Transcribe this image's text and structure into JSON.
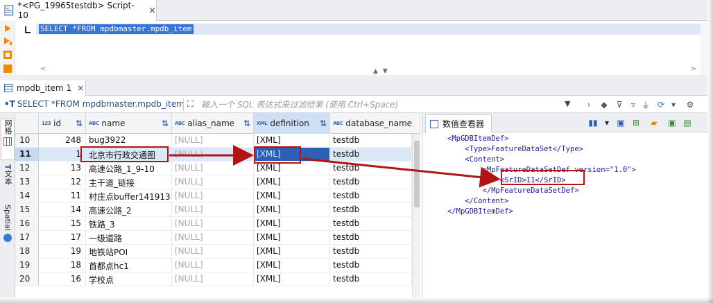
{
  "editor": {
    "tab_title": "*<PG_19965testdb> Script-10",
    "sql": "SELECT *FROM mpdbmaster.mpdb_item"
  },
  "results": {
    "tab_label": "mpdb_item 1",
    "query_text": "SELECT *FROM mpdbmaster.mpdb_item",
    "filter_placeholder": "输入一个 SQL 表达式来过滤结果 (使用 Ctrl+Space)",
    "side_tabs": [
      "网格",
      "文本",
      "Spatial"
    ],
    "columns": [
      {
        "type": "123",
        "name": "id"
      },
      {
        "type": "ABC",
        "name": "name"
      },
      {
        "type": "ABC",
        "name": "alias_name"
      },
      {
        "type": "XML",
        "name": "definition"
      },
      {
        "type": "ABC",
        "name": "database_name"
      }
    ],
    "rows": [
      {
        "n": "10",
        "id": "248",
        "name": "bug3922",
        "alias": "[NULL]",
        "def": "[XML]",
        "db": "testdb"
      },
      {
        "n": "11",
        "id": "1",
        "name": "北京市行政交通图",
        "alias": "[NULL]",
        "def": "[XML]",
        "db": "testdb"
      },
      {
        "n": "12",
        "id": "13",
        "name": "高速公路_1_9-10",
        "alias": "[NULL]",
        "def": "[XML]",
        "db": "testdb"
      },
      {
        "n": "13",
        "id": "12",
        "name": "主干道_链接",
        "alias": "[NULL]",
        "def": "[XML]",
        "db": "testdb"
      },
      {
        "n": "14",
        "id": "11",
        "name": "村庄点buffer141913",
        "alias": "[NULL]",
        "def": "[XML]",
        "db": "testdb"
      },
      {
        "n": "15",
        "id": "14",
        "name": "高速公路_2",
        "alias": "[NULL]",
        "def": "[XML]",
        "db": "testdb"
      },
      {
        "n": "16",
        "id": "15",
        "name": "铁路_3",
        "alias": "[NULL]",
        "def": "[XML]",
        "db": "testdb"
      },
      {
        "n": "17",
        "id": "17",
        "name": "一级道路",
        "alias": "[NULL]",
        "def": "[XML]",
        "db": "testdb"
      },
      {
        "n": "18",
        "id": "19",
        "name": "地铁站POI",
        "alias": "[NULL]",
        "def": "[XML]",
        "db": "testdb"
      },
      {
        "n": "19",
        "id": "18",
        "name": "首都点hc1",
        "alias": "[NULL]",
        "def": "[XML]",
        "db": "testdb"
      },
      {
        "n": "20",
        "id": "16",
        "name": "学校点",
        "alias": "[NULL]",
        "def": "[XML]",
        "db": "testdb"
      }
    ],
    "selected_row_index": 1
  },
  "viewer": {
    "tab_label": "数值查看器",
    "xml_lines": [
      "<MpGDBItemDef>",
      "    <Type>FeatureDataSet</Type>",
      "    <Content>",
      "        <MpFeatureDataSetDef version=\"1.0\">",
      "            <SrID>11</SrID>",
      "        </MpFeatureDataSetDef>",
      "    </Content>",
      "</MpGDBItemDef>"
    ]
  },
  "colors": {
    "accent": "#3a73d6",
    "annotation": "#b01414",
    "selected_row": "#dde8f7",
    "null_text": "#a8a8a8"
  }
}
